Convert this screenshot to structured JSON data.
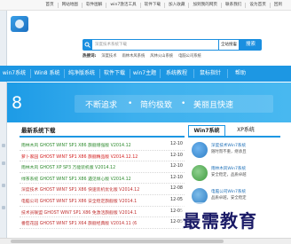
{
  "topbar": {
    "links": [
      "首页",
      "网站地图",
      "软件图解",
      "win7激活工具",
      "软件下载",
      "加入收藏",
      "加到我的网页",
      "联系我们",
      "设为首页",
      "回到"
    ]
  },
  "search": {
    "placeholder": "深度技术系统下载",
    "select_value": "全站搜索",
    "button_label": "搜索"
  },
  "hot": {
    "label": "热搜词:",
    "terms": [
      "深度技术",
      "雨林木风系统",
      "风林火山系统",
      "电脑公司系统"
    ]
  },
  "nav": {
    "items": [
      "win7系统",
      "Win8 系统",
      "纯净版系统",
      "软件下载",
      "win7主题",
      "系统教程",
      "鼠标指针",
      "帮助"
    ]
  },
  "banner": {
    "big": "8",
    "slogans": [
      "不断追求",
      "简约极致",
      "美丽且快速"
    ],
    "bullet": "•"
  },
  "latest": {
    "title": "最新系统下载",
    "items": [
      {
        "name": "雨林木风 GHOST WIN7 SP1 X86 旗舰增强版 V2014.12",
        "date": "12-10",
        "color": "#2e8b2e"
      },
      {
        "name": "萝卜家园 GHOST WIN7 SP1 X86 旗舰精品版 V2014.12.12",
        "date": "12-10",
        "color": "#d42020"
      },
      {
        "name": "雨林木风 GHOST XP SP3 万能装机版 V2014.12",
        "date": "12-10",
        "color": "#2e8b2e"
      },
      {
        "name": "绿茶系统 GHOST WIN7 SP1 X86 遇见倾心版 V2014.12",
        "date": "12-10",
        "color": "#2e8b2e"
      },
      {
        "name": "深度技术 GHOST WIN7 SP1 X86 快速装机优化版 V2014.12",
        "date": "12-08",
        "color": "#c03030"
      },
      {
        "name": "电脑公司 GHOST WIN7 SP1 X86 安全稳定旗舰版 V2014.1",
        "date": "12-05",
        "color": "#c03030"
      },
      {
        "name": "技术员联盟 GHOST WIN7 SP1 X86 免激活旗舰版 V2014.1",
        "date": "12-05",
        "color": "#c03030"
      },
      {
        "name": "番茄花园 GHOST WIN7 SP1 X64 旗舰经典版 V2014.11 (6",
        "date": "12-05",
        "color": "#c03030"
      }
    ]
  },
  "right": {
    "tabs": [
      "Win7系统",
      "XP系统"
    ],
    "items": [
      {
        "title": "深度技术Win7系统",
        "sub": "随时而不重，继承且",
        "icon_color": "#2f7fc6"
      },
      {
        "title": "雨林木风Win7系统",
        "sub": "安全稳定，品质卓越",
        "icon_color": "#3e9b3e"
      },
      {
        "title": "电脑公司Win7系统",
        "sub": "品质卓越，安全稳定",
        "icon_color": "#2f7fc6"
      }
    ]
  },
  "watermark": "最需教育",
  "colors": {
    "accent": "#1d97e3",
    "nav_active": "#1580c8"
  }
}
